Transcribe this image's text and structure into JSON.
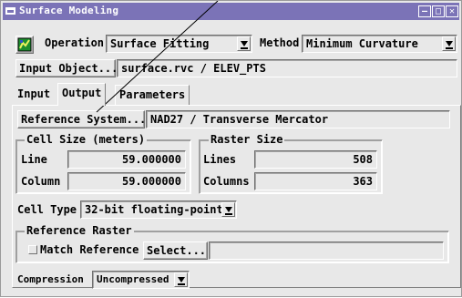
{
  "window": {
    "title": "Surface Modeling"
  },
  "toolbar": {
    "operation_label": "Operation",
    "operation_value": "Surface Fitting",
    "method_label": "Method",
    "method_value": "Minimum Curvature"
  },
  "input_object": {
    "button_label": "Input Object...",
    "value": "surface.rvc / ELEV_PTS"
  },
  "tabs": [
    {
      "label": "Input"
    },
    {
      "label": "Output"
    },
    {
      "label": "Parameters"
    }
  ],
  "reference_system": {
    "button_label": "Reference System...",
    "value": "NAD27 / Transverse Mercator"
  },
  "cell_size": {
    "legend": "Cell Size (meters)",
    "line_label": "Line",
    "line_value": "59.000000",
    "column_label": "Column",
    "column_value": "59.000000"
  },
  "raster_size": {
    "legend": "Raster Size",
    "lines_label": "Lines",
    "lines_value": "508",
    "columns_label": "Columns",
    "columns_value": "363"
  },
  "cell_type": {
    "label": "Cell Type",
    "value": "32-bit floating-point"
  },
  "reference_raster": {
    "legend": "Reference Raster",
    "match_label": "Match Reference",
    "match_checked": false,
    "select_label": "Select...",
    "select_value": ""
  },
  "compression": {
    "label": "Compression",
    "value": "Uncompressed"
  }
}
